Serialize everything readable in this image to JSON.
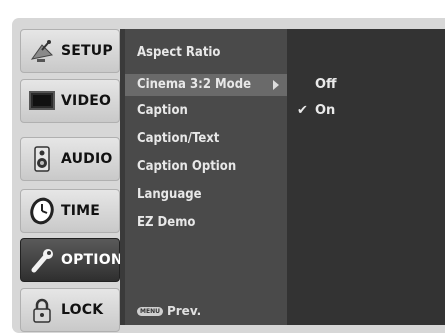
{
  "categories": [
    {
      "label": "SETUP",
      "icon": "satellite-dish-icon"
    },
    {
      "label": "VIDEO",
      "icon": "monitor-icon"
    },
    {
      "label": "AUDIO",
      "icon": "speaker-icon"
    },
    {
      "label": "TIME",
      "icon": "clock-icon"
    },
    {
      "label": "OPTION",
      "icon": "wrench-icon",
      "active": true
    },
    {
      "label": "LOCK",
      "icon": "padlock-icon"
    }
  ],
  "menu": {
    "items": [
      {
        "label": "Aspect Ratio"
      },
      {
        "label": "Cinema 3:2 Mode",
        "selected": true
      },
      {
        "label": "Caption"
      },
      {
        "label": "Caption/Text"
      },
      {
        "label": "Caption Option"
      },
      {
        "label": "Language"
      },
      {
        "label": "EZ Demo"
      }
    ],
    "footer_key": "MENU",
    "footer_label": "Prev."
  },
  "submenu": {
    "options": [
      {
        "label": "Off",
        "checked": false
      },
      {
        "label": "On",
        "checked": true
      }
    ],
    "check_mark": "✔"
  }
}
